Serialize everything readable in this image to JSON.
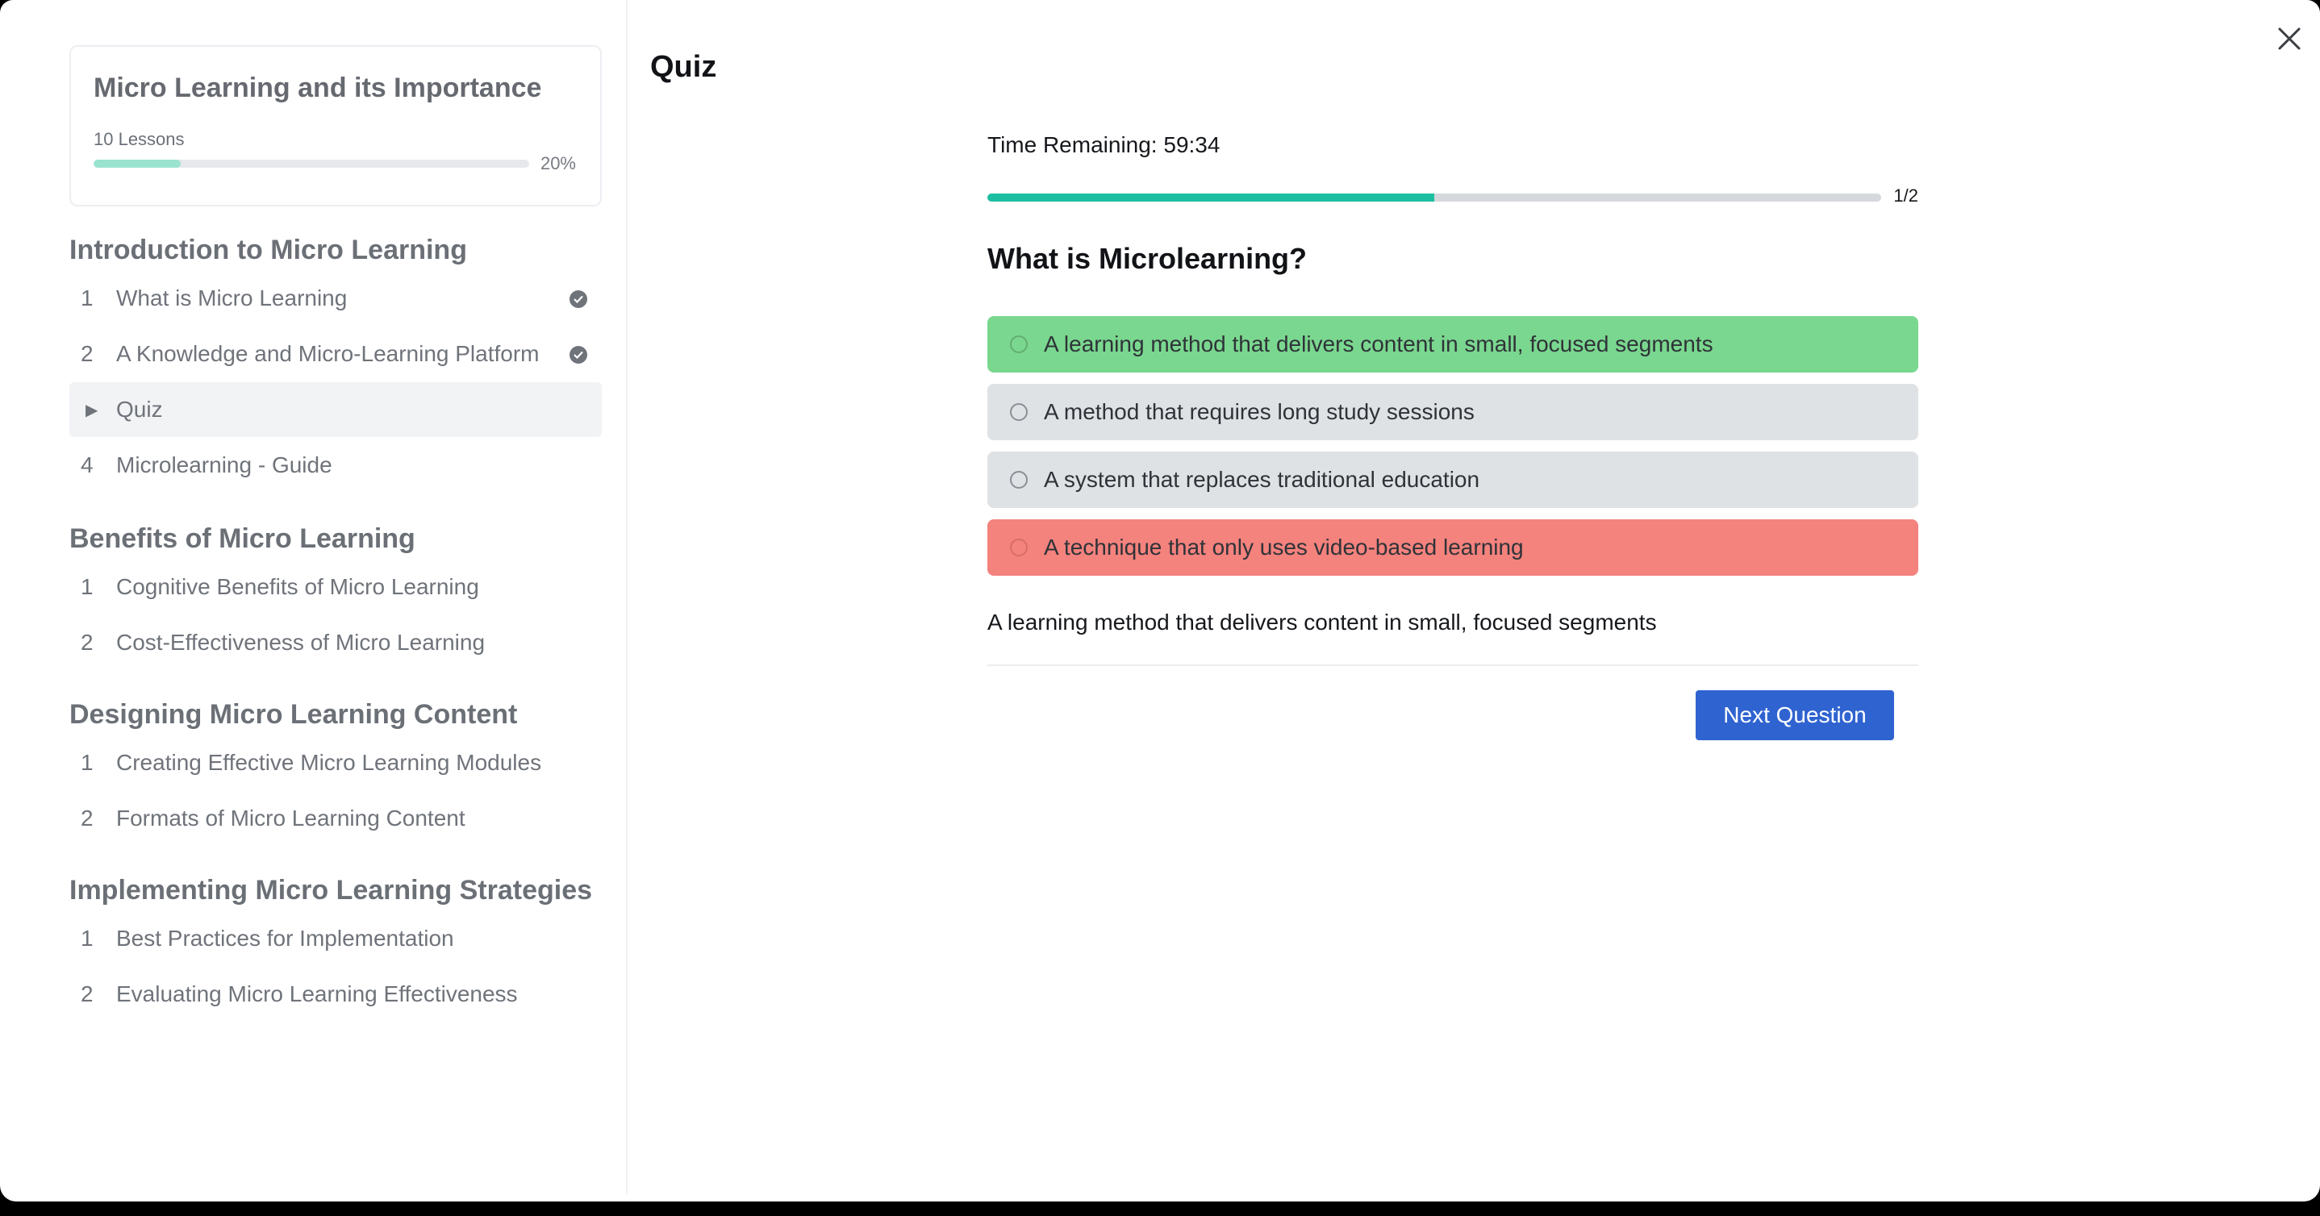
{
  "course": {
    "title": "Micro Learning and its Importance",
    "lessons_count": "10 Lessons",
    "progress_percent": 20,
    "progress_label": "20%"
  },
  "sections": [
    {
      "title": "Introduction to Micro Learning",
      "lessons": [
        {
          "number": "1",
          "label": "What is Micro Learning",
          "completed": true
        },
        {
          "number": "2",
          "label": "A Knowledge and Micro-Learning Platform",
          "completed": true
        },
        {
          "number": "",
          "label": "Quiz",
          "active": true,
          "icon": "play-triangle-icon"
        },
        {
          "number": "4",
          "label": "Microlearning - Guide"
        }
      ]
    },
    {
      "title": "Benefits of Micro Learning",
      "lessons": [
        {
          "number": "1",
          "label": "Cognitive Benefits of Micro Learning"
        },
        {
          "number": "2",
          "label": "Cost-Effectiveness of Micro Learning"
        }
      ]
    },
    {
      "title": "Designing Micro Learning Content",
      "lessons": [
        {
          "number": "1",
          "label": "Creating Effective Micro Learning Modules"
        },
        {
          "number": "2",
          "label": "Formats of Micro Learning Content"
        }
      ]
    },
    {
      "title": "Implementing Micro Learning Strategies",
      "lessons": [
        {
          "number": "1",
          "label": "Best Practices for Implementation"
        },
        {
          "number": "2",
          "label": "Evaluating Micro Learning Effectiveness"
        }
      ]
    }
  ],
  "quiz": {
    "header": "Quiz",
    "timer": "Time Remaining: 59:34",
    "progress_fraction": 0.5,
    "progress_label": "1/2",
    "question": "What is Microlearning?",
    "options": [
      {
        "text": "A learning method that delivers content in small, focused segments",
        "state": "correct"
      },
      {
        "text": "A method that requires long study sessions",
        "state": "neutral"
      },
      {
        "text": "A system that replaces traditional education",
        "state": "neutral"
      },
      {
        "text": "A technique that only uses video-based learning",
        "state": "wrong"
      }
    ],
    "answer": "A learning method that delivers content in small, focused segments",
    "next_button": "Next Question"
  },
  "colors": {
    "correct": "#7ad78f",
    "wrong": "#f4827d",
    "neutral": "#dfe2e5",
    "accent": "#2f63d0",
    "progress": "#1cbf9f"
  },
  "icons": {
    "close": "close-icon",
    "completed": "check-circle-icon",
    "active_lesson": "play-triangle-icon",
    "option": "radio-icon"
  }
}
